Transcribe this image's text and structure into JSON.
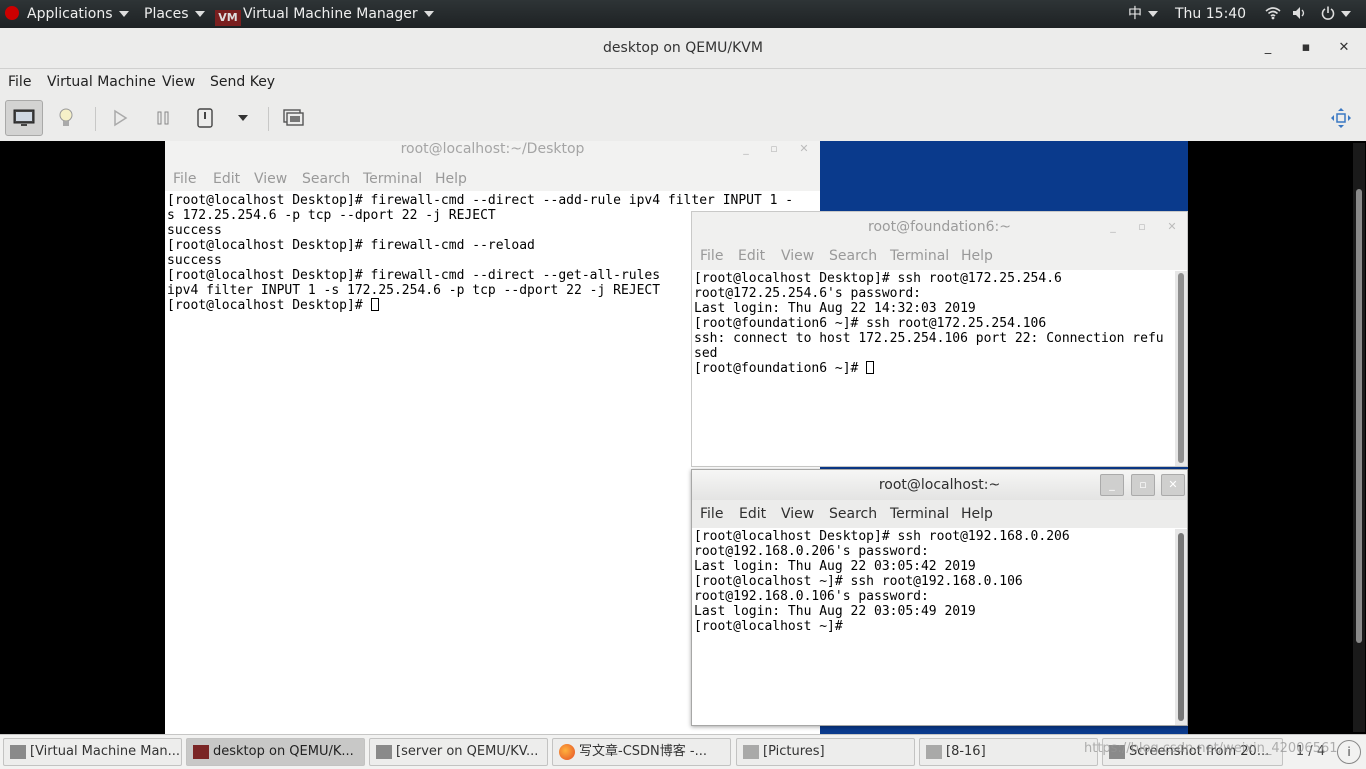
{
  "topbar": {
    "applications": "Applications",
    "places": "Places",
    "app_name": "Virtual Machine Manager",
    "input_method": "中",
    "clock": "Thu 15:40"
  },
  "vmm": {
    "title": "desktop on QEMU/KVM",
    "menu": [
      "File",
      "Virtual Machine",
      "View",
      "Send Key"
    ]
  },
  "term_desktop": {
    "title": "root@localhost:~/Desktop",
    "menu": [
      "File",
      "Edit",
      "View",
      "Search",
      "Terminal",
      "Help"
    ],
    "lines": [
      "[root@localhost Desktop]# firewall-cmd --direct --add-rule ipv4 filter INPUT 1 -",
      "s 172.25.254.6 -p tcp --dport 22 -j REJECT",
      "success",
      "[root@localhost Desktop]# firewall-cmd --reload",
      "success",
      "[root@localhost Desktop]# firewall-cmd --direct --get-all-rules",
      "ipv4 filter INPUT 1 -s 172.25.254.6 -p tcp --dport 22 -j REJECT",
      "[root@localhost Desktop]# "
    ]
  },
  "term_foundation": {
    "title": "root@foundation6:~",
    "menu": [
      "File",
      "Edit",
      "View",
      "Search",
      "Terminal",
      "Help"
    ],
    "lines": [
      "[root@localhost Desktop]# ssh root@172.25.254.6",
      "root@172.25.254.6's password:",
      "Last login: Thu Aug 22 14:32:03 2019",
      "[root@foundation6 ~]# ssh root@172.25.254.106",
      "ssh: connect to host 172.25.254.106 port 22: Connection refu",
      "sed",
      "[root@foundation6 ~]# "
    ]
  },
  "term_localhost": {
    "title": "root@localhost:~",
    "menu": [
      "File",
      "Edit",
      "View",
      "Search",
      "Terminal",
      "Help"
    ],
    "lines": [
      "[root@localhost Desktop]# ssh root@192.168.0.206",
      "root@192.168.0.206's password:",
      "Last login: Thu Aug 22 03:05:42 2019",
      "[root@localhost ~]# ssh root@192.168.0.106",
      "root@192.168.0.106's password:",
      "Last login: Thu Aug 22 03:05:49 2019",
      "[root@localhost ~]# "
    ]
  },
  "taskbar": {
    "tasks": [
      "[Virtual Machine Man...",
      "desktop on QEMU/K...",
      "[server on QEMU/KV...",
      "写文章-CSDN博客 -...",
      "[Pictures]",
      "[8-16]",
      "Screenshot from 20..."
    ],
    "workspace": "1 / 4",
    "watermark": "https://blog.csdn.net/weixin_42006561"
  },
  "colors": {
    "blue_desktop": "#0a3a8c",
    "topbar": "#2e3436"
  }
}
